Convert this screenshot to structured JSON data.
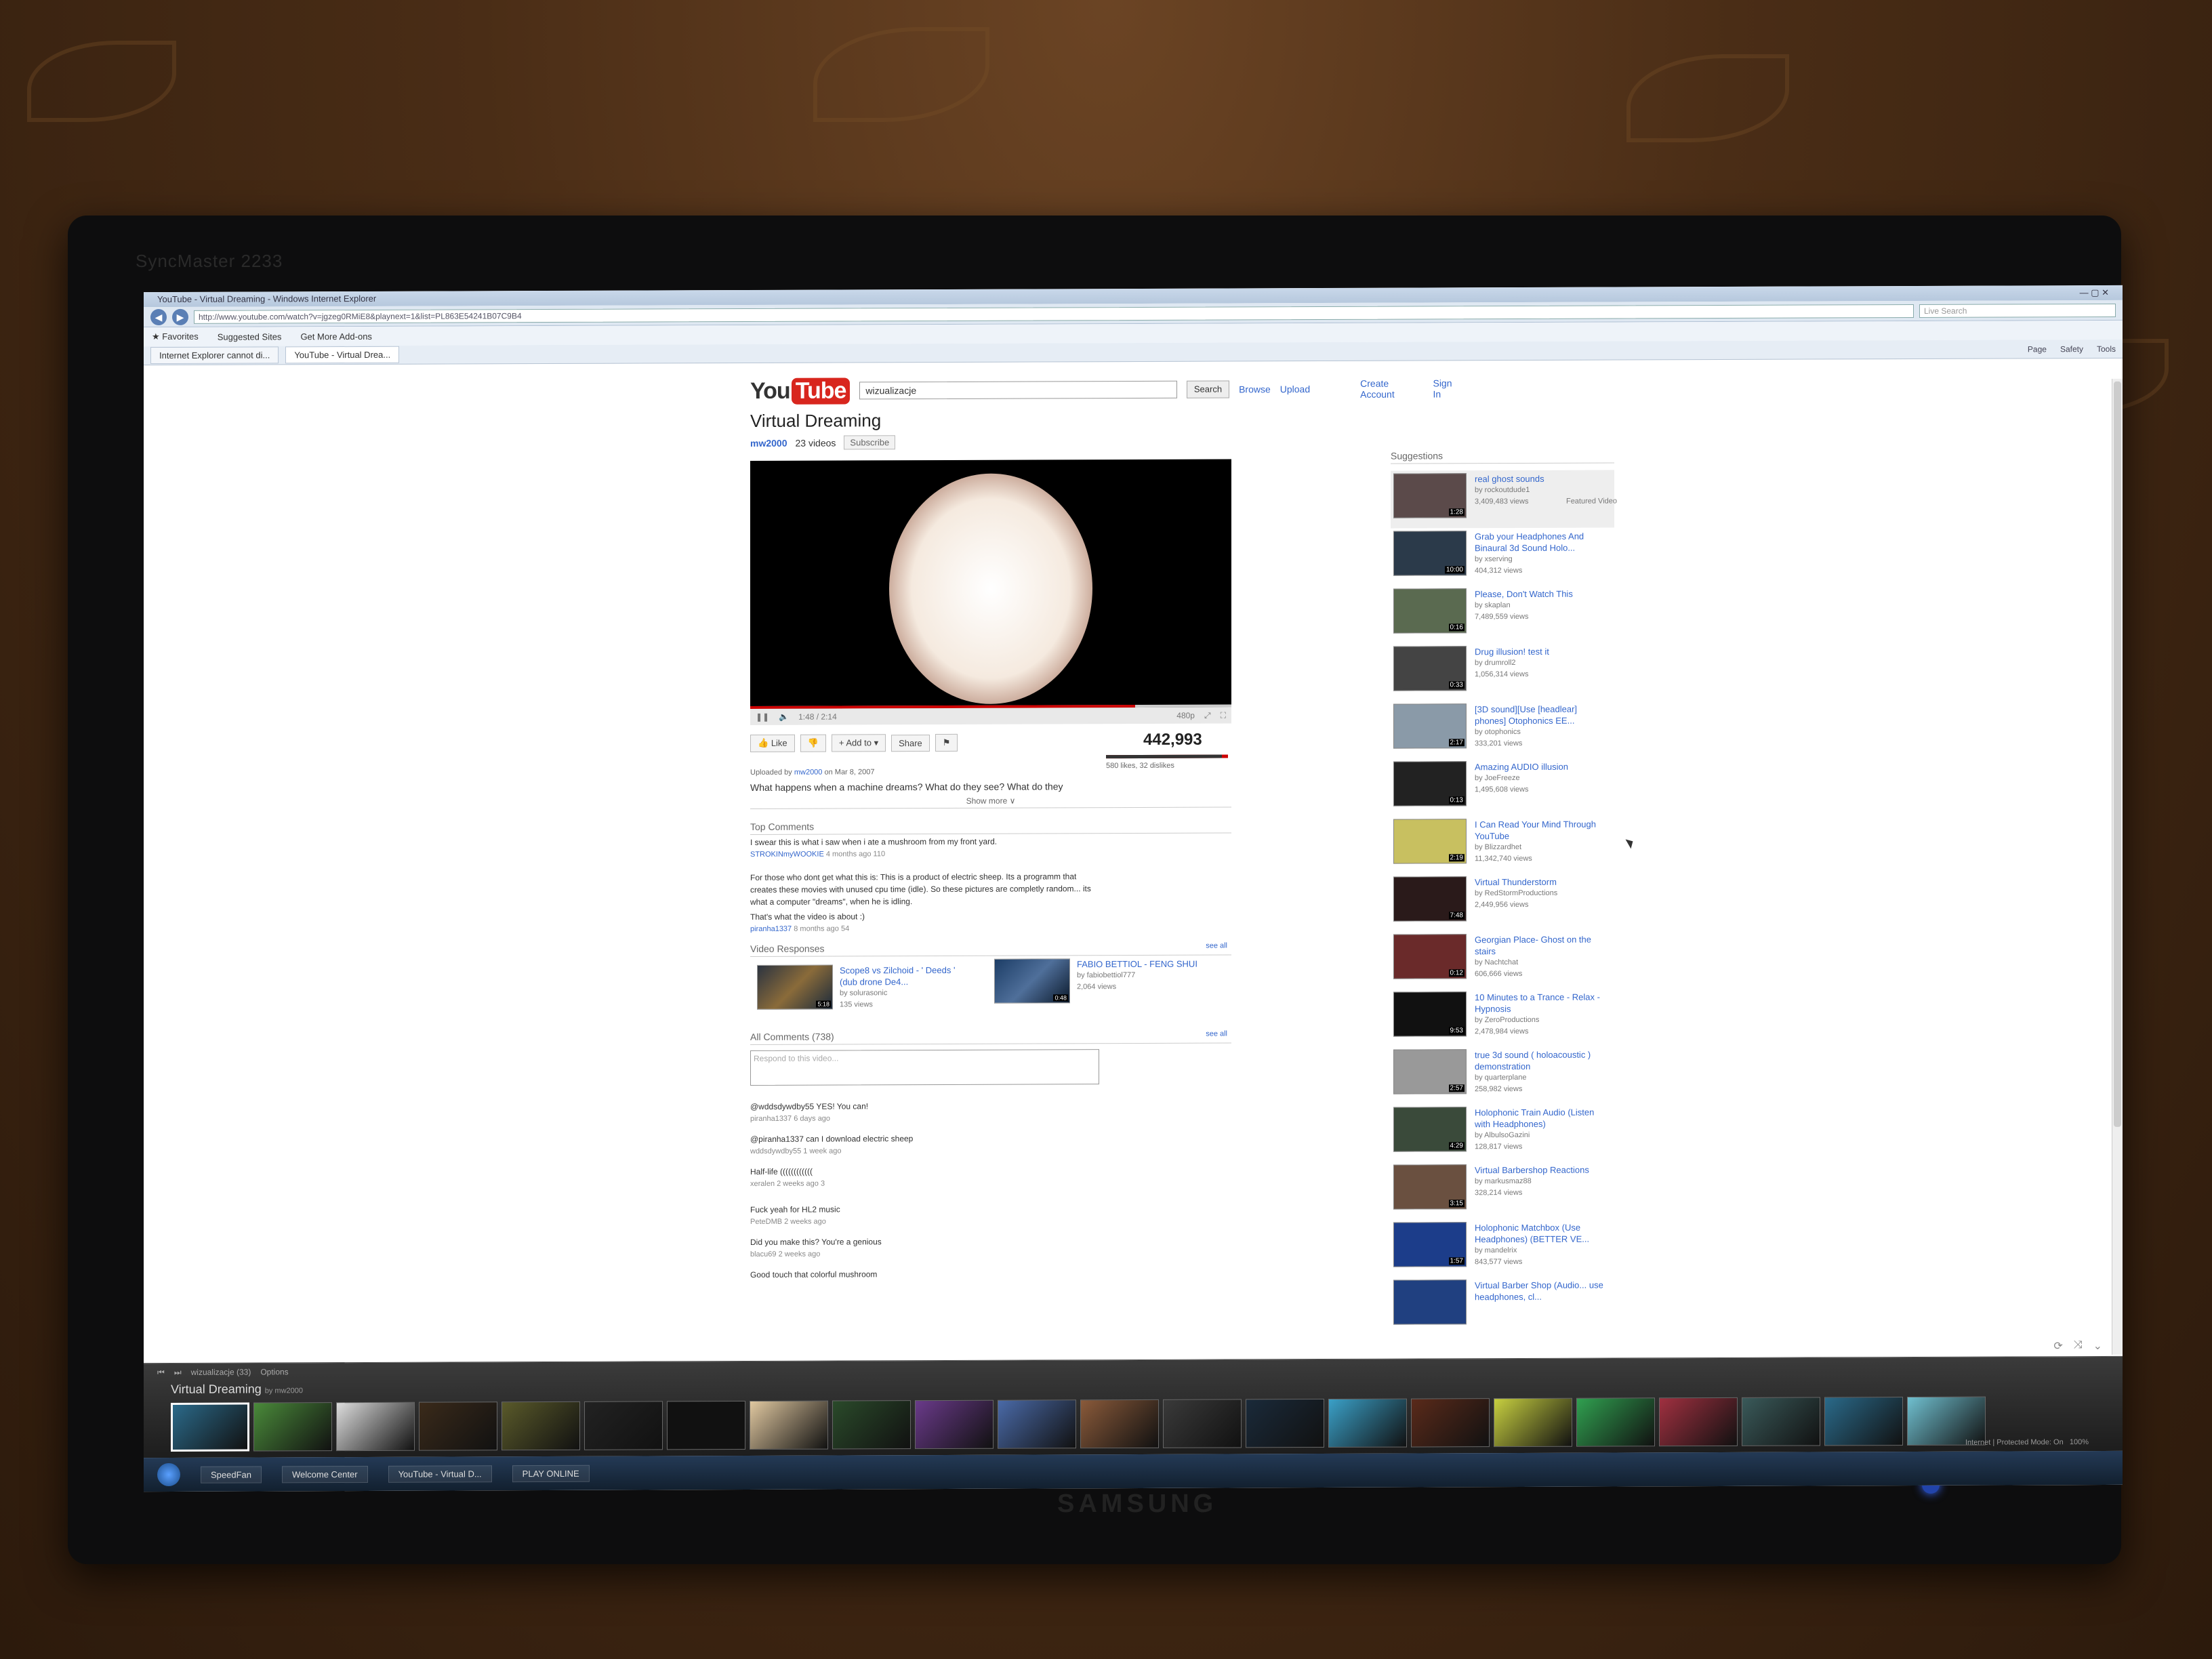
{
  "browser": {
    "window_title": "YouTube - Virtual Dreaming - Windows Internet Explorer",
    "url": "http://www.youtube.com/watch?v=jgzeg0RMiE8&playnext=1&list=PL863E54241B07C9B4",
    "live_search_placeholder": "Live Search",
    "favorites": "Favorites",
    "suggested_sites": "Suggested Sites",
    "get_addons": "Get More Add-ons",
    "tabs": [
      {
        "label": "Internet Explorer cannot di..."
      },
      {
        "label": "YouTube - Virtual Drea..."
      }
    ],
    "commands": [
      "Page",
      "Safety",
      "Tools"
    ]
  },
  "header": {
    "logo_you": "You",
    "logo_tube": "Tube",
    "search_value": "wizualizacje",
    "search_button": "Search",
    "browse": "Browse",
    "upload": "Upload",
    "create_account": "Create Account",
    "sign_in": "Sign In"
  },
  "video": {
    "title": "Virtual Dreaming",
    "uploader": "mw2000",
    "video_count": "23 videos",
    "subscribe": "Subscribe",
    "time": "1:48 / 2:14",
    "quality": "480p",
    "progress": 0.8,
    "views": "442,993",
    "likes_text": "580 likes, 32 dislikes",
    "uploaded_prefix": "Uploaded by",
    "uploaded_suffix": "on Mar 8, 2007",
    "description": "What happens when a machine dreams? What do they see? What do they",
    "show_more": "Show more",
    "like": "Like",
    "add_to": "Add to",
    "share": "Share"
  },
  "top_comments": {
    "heading": "Top Comments",
    "items": [
      {
        "text": "I swear this is what i saw when i ate a mushroom from my front yard.",
        "author": "STROKINmyWOOKIE",
        "meta": "4 months ago 110"
      },
      {
        "text": "For those who dont get what this is: This is a product of electric sheep. Its a programm that creates these movies with unused cpu time (idle). So these pictures are completly random... its what a computer \"dreams\", when he is idling.",
        "text2": "That's what the video is about :)",
        "author": "piranha1337",
        "meta": "8 months ago 54"
      }
    ]
  },
  "video_responses": {
    "heading": "Video Responses",
    "see_all": "see all",
    "items": [
      {
        "title": "Scope8 vs Zilchoid - ' Deeds ' (dub drone De4...",
        "by": "by solurasonic",
        "views": "135 views",
        "duration": "5:18"
      },
      {
        "title": "FABIO BETTIOL - FENG SHUI",
        "by": "by fabiobettiol777",
        "views": "2,064 views",
        "duration": "0:48"
      }
    ]
  },
  "all_comments": {
    "heading": "All Comments (738)",
    "see_all": "see all",
    "placeholder": "Respond to this video...",
    "items": [
      {
        "text": "@wddsdywdby55 YES! You can!",
        "meta": "piranha1337 6 days ago"
      },
      {
        "text": "@piranha1337 can I download electric sheep",
        "meta": "wddsdywdby55 1 week ago"
      },
      {
        "text": "Half-life ((((((((((((",
        "meta": "xeralen 2 weeks ago 3"
      },
      {
        "text": "Fuck yeah for HL2 music",
        "meta": "PeteDMB 2 weeks ago"
      },
      {
        "text": "Did you make this? You're a genious",
        "meta": "blacu69 2 weeks ago"
      },
      {
        "text": "Good touch that colorful mushroom",
        "meta": ""
      }
    ]
  },
  "suggestions": {
    "heading": "Suggestions",
    "featured_label": "Featured Video",
    "items": [
      {
        "title": "real ghost sounds",
        "by": "by rockoutdude1",
        "views": "3,409,483 views",
        "duration": "1:28"
      },
      {
        "title": "Grab your Headphones And Binaural 3d Sound Holo...",
        "by": "by xserving",
        "views": "404,312 views",
        "duration": "10:00"
      },
      {
        "title": "Please, Don't Watch This",
        "by": "by skaplan",
        "views": "7,489,559 views",
        "duration": "0:16"
      },
      {
        "title": "Drug illusion! test it",
        "by": "by drumroll2",
        "views": "1,056,314 views",
        "duration": "0:33"
      },
      {
        "title": "[3D sound][Use [headlear] phones] Otophonics EE...",
        "by": "by otophonics",
        "views": "333,201 views",
        "duration": "2:17"
      },
      {
        "title": "Amazing AUDIO illusion",
        "by": "by JoeFreeze",
        "views": "1,495,608 views",
        "duration": "0:13"
      },
      {
        "title": "I Can Read Your Mind Through YouTube",
        "by": "by Blizzardhet",
        "views": "11,342,740 views",
        "duration": "2:19"
      },
      {
        "title": "Virtual Thunderstorm",
        "by": "by RedStormProductions",
        "views": "2,449,956 views",
        "duration": "7:48"
      },
      {
        "title": "Georgian Place- Ghost on the stairs",
        "by": "by Nachtchat",
        "views": "606,666 views",
        "duration": "0:12"
      },
      {
        "title": "10 Minutes to a Trance - Relax - Hypnosis",
        "by": "by ZeroProductions",
        "views": "2,478,984 views",
        "duration": "9:53"
      },
      {
        "title": "true 3d sound ( holoacoustic ) demonstration",
        "by": "by quarterplane",
        "views": "258,982 views",
        "duration": "2:57"
      },
      {
        "title": "Holophonic Train Audio (Listen with Headphones)",
        "by": "by AlbulsoGazini",
        "views": "128,817 views",
        "duration": "4:29"
      },
      {
        "title": "Virtual Barbershop Reactions",
        "by": "by markusmaz88",
        "views": "328,214 views",
        "duration": "3:15"
      },
      {
        "title": "Holophonic Matchbox (Use Headphones) (BETTER VE...",
        "by": "by mandelrix",
        "views": "843,577 views",
        "duration": "1:57"
      },
      {
        "title": "Virtual Barber Shop (Audio... use headphones, cl...",
        "by": "",
        "views": "",
        "duration": ""
      }
    ]
  },
  "playlist_bar": {
    "playlist_name": "wizualizacje (33)",
    "options": "Options",
    "current_title": "Virtual Dreaming",
    "by": "by mw2000",
    "status": "Internet | Protected Mode: On",
    "zoom": "100%"
  },
  "taskbar": {
    "items": [
      "SpeedFan",
      "Welcome Center",
      "YouTube - Virtual D...",
      "PLAY ONLINE"
    ]
  },
  "monitor": {
    "model": "SyncMaster 2233",
    "brand": "SAMSUNG"
  },
  "colors": {
    "yt_red": "#d8261e",
    "link_blue": "#3366cc",
    "player_bg": "#000000"
  }
}
